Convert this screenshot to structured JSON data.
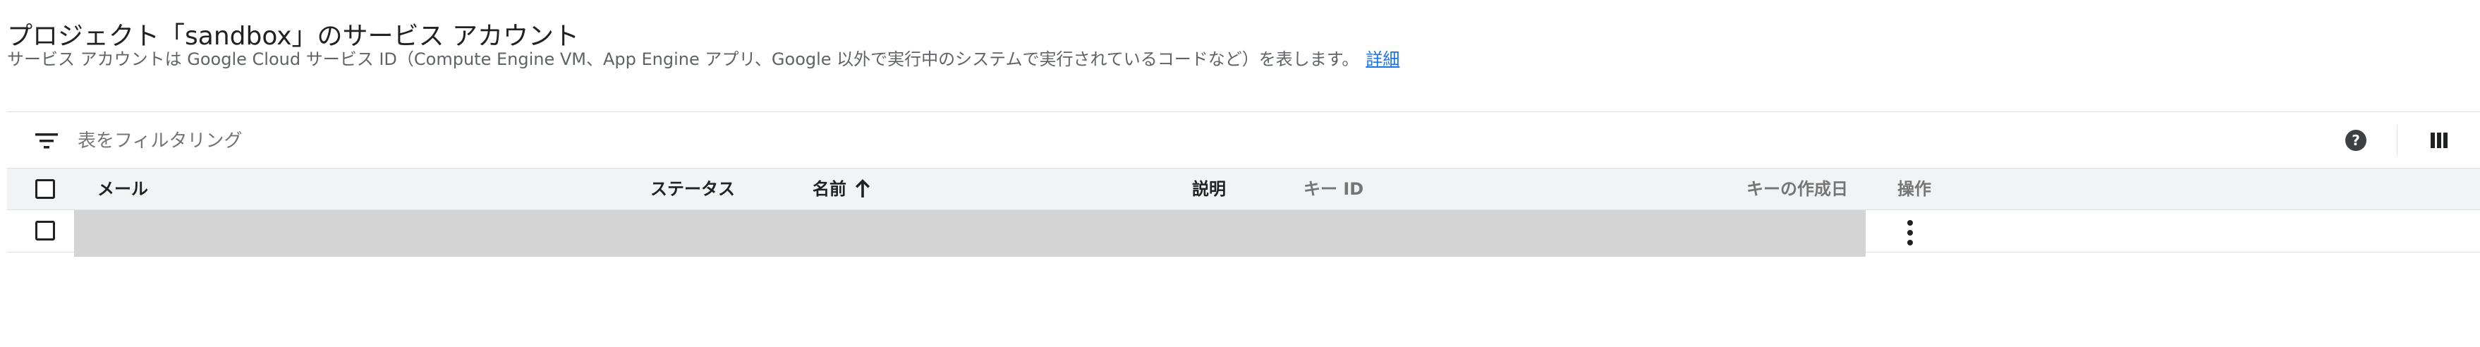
{
  "page": {
    "title": "プロジェクト「sandbox」のサービス アカウント",
    "description": "サービス アカウントは Google Cloud サービス ID（Compute Engine VM、App Engine アプリ、Google 以外で実行中のシステムで実行されているコードなど）を表します。",
    "learn_more": "詳細"
  },
  "filter": {
    "placeholder": "表をフィルタリング",
    "filter_icon": "filter-list-icon",
    "help_icon": "help-circle-icon",
    "columns_icon": "view-column-icon"
  },
  "table": {
    "columns": {
      "email": "メール",
      "status": "ステータス",
      "name": "名前",
      "description": "説明",
      "key_id": "キー ID",
      "key_created": "キーの作成日",
      "actions": "操作"
    },
    "sort": {
      "column": "name",
      "direction": "ascending",
      "icon": "arrow-upward-icon"
    },
    "rows": [
      {
        "content": "",
        "redacted": true,
        "actions_icon": "more-vert-icon"
      }
    ]
  },
  "colors": {
    "link": "#1a73e8",
    "header_bg": "#f1f3f4",
    "redacted": "#d4d4d4",
    "text": "#202124",
    "muted": "#757575"
  }
}
